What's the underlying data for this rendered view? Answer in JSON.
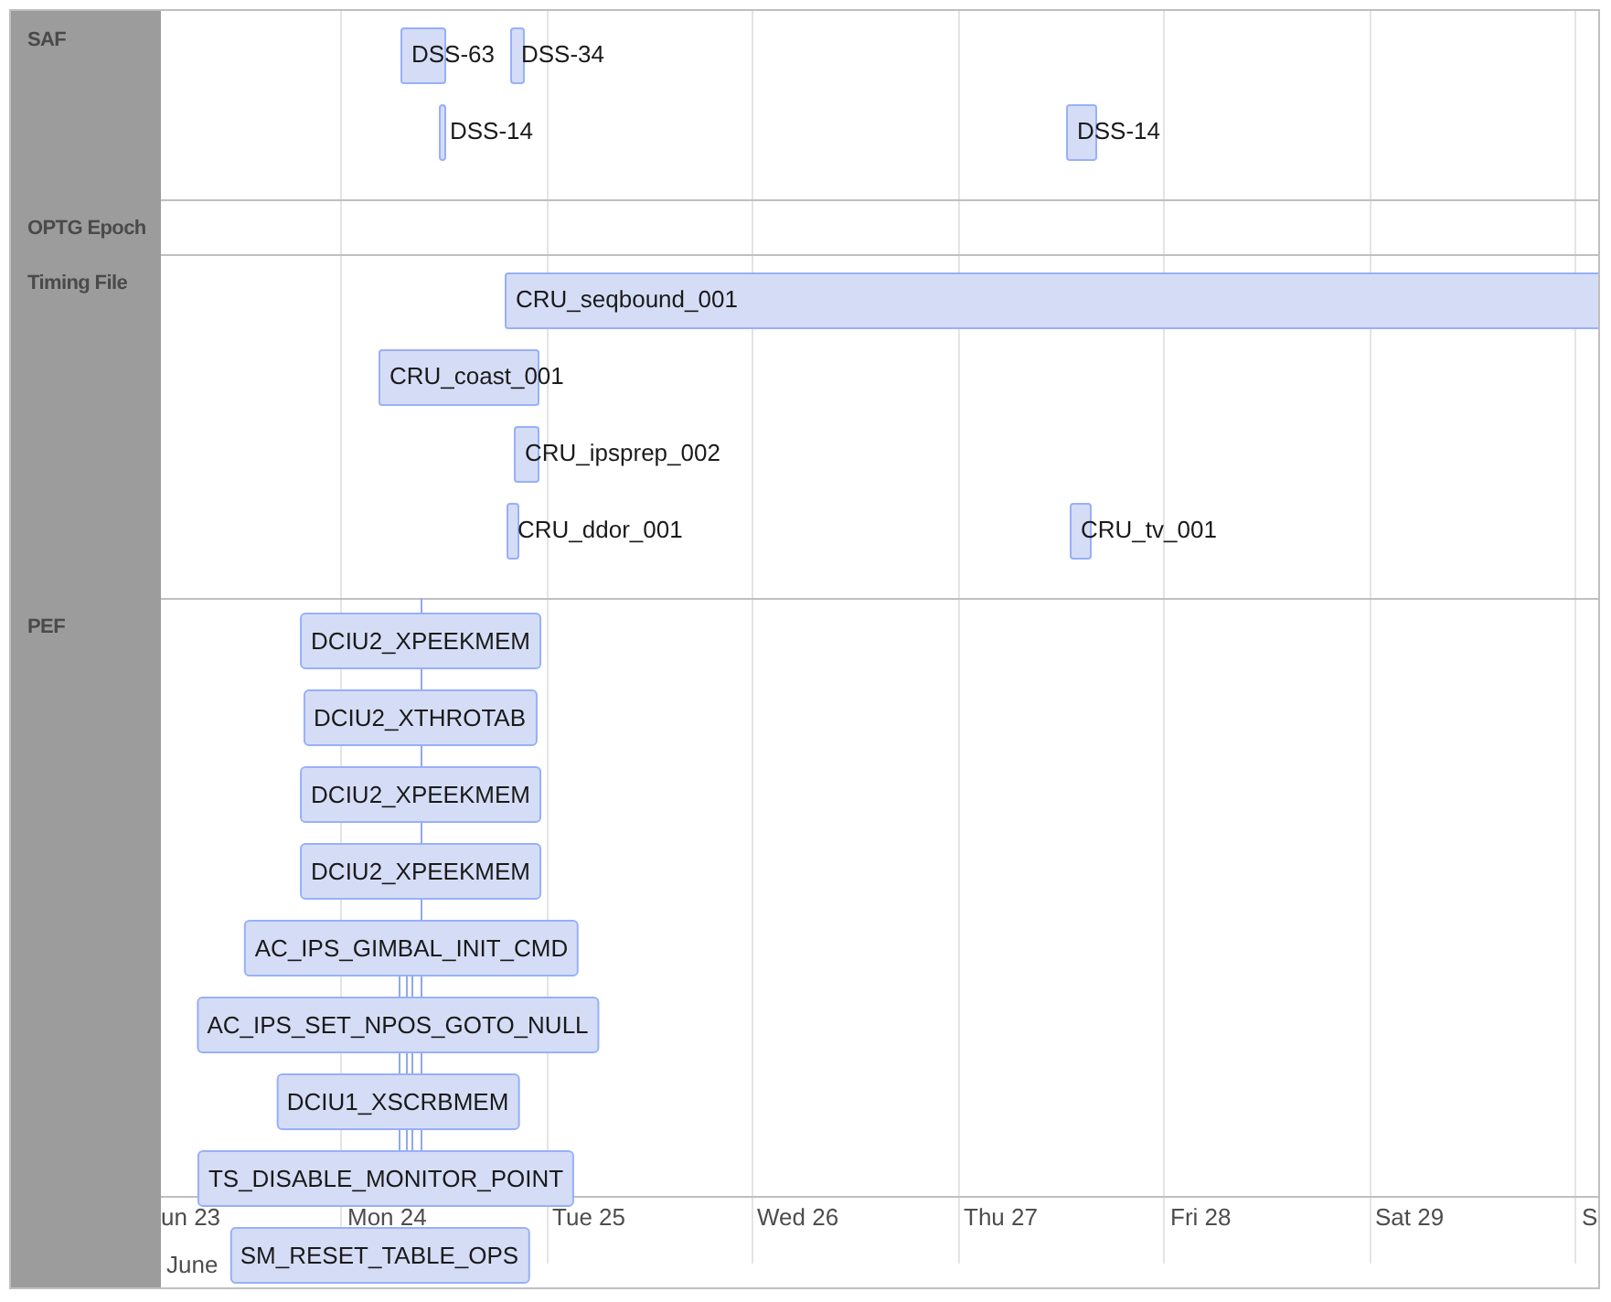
{
  "groups": [
    {
      "label": "SAF",
      "kind": "range",
      "items": [
        {
          "label": "DSS-63"
        },
        {
          "label": "DSS-34"
        },
        {
          "label": "DSS-14"
        },
        {
          "label": "DSS-14"
        }
      ]
    },
    {
      "label": "OPTG Epoch"
    },
    {
      "label": "Timing File",
      "kind": "range",
      "items": [
        {
          "label": "CRU_seqbound_001"
        },
        {
          "label": "CRU_coast_001"
        },
        {
          "label": "CRU_ipsprep_002"
        },
        {
          "label": "CRU_ddor_001"
        },
        {
          "label": "CRU_tv_001"
        }
      ]
    },
    {
      "label": "PEF",
      "kind": "box",
      "items": [
        {
          "label": "DCIU2_XPEEKMEM"
        },
        {
          "label": "DCIU2_XTHROTAB"
        },
        {
          "label": "DCIU2_XPEEKMEM"
        },
        {
          "label": "DCIU2_XPEEKMEM"
        },
        {
          "label": "AC_IPS_GIMBAL_INIT_CMD"
        },
        {
          "label": "AC_IPS_SET_NPOS_GOTO_NULL"
        },
        {
          "label": "DCIU1_XSCRBMEM"
        },
        {
          "label": "TS_DISABLE_MONITOR_POINT"
        },
        {
          "label": "SM_RESET_TABLE_OPS"
        }
      ]
    }
  ],
  "axis": {
    "minor_labels": [
      "un 23",
      "Mon 24",
      "Tue 25",
      "Wed 26",
      "Thu 27",
      "Fri 28",
      "Sat 29",
      "S"
    ],
    "major_label": "June"
  }
}
